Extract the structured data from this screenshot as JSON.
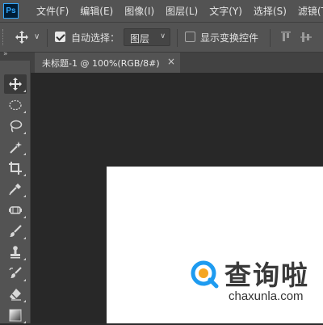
{
  "app": {
    "logo_text": "Ps"
  },
  "menu": {
    "items": [
      "文件(F)",
      "编辑(E)",
      "图像(I)",
      "图层(L)",
      "文字(Y)",
      "选择(S)",
      "滤镜(T)"
    ]
  },
  "options": {
    "auto_select_label": "自动选择：",
    "auto_select_checked": true,
    "layer_select_value": "图层",
    "show_transform_label": "显示变换控件",
    "show_transform_checked": false
  },
  "tools_panel": {
    "collapse_glyph": "»",
    "tools": [
      {
        "name": "move-tool-icon",
        "active": true
      },
      {
        "name": "marquee-tool-icon",
        "active": false
      },
      {
        "name": "lasso-tool-icon",
        "active": false
      },
      {
        "name": "magic-wand-tool-icon",
        "active": false
      },
      {
        "name": "crop-tool-icon",
        "active": false
      },
      {
        "name": "eyedropper-tool-icon",
        "active": false
      },
      {
        "name": "healing-brush-tool-icon",
        "active": false
      },
      {
        "name": "brush-tool-icon",
        "active": false
      },
      {
        "name": "clone-stamp-tool-icon",
        "active": false
      },
      {
        "name": "history-brush-tool-icon",
        "active": false
      },
      {
        "name": "eraser-tool-icon",
        "active": false
      },
      {
        "name": "gradient-tool-icon",
        "active": false
      }
    ]
  },
  "document_tab": {
    "title": "未标题-1 @ 100%(RGB/8#)",
    "close_glyph": "×"
  },
  "watermark": {
    "brand": "查询啦",
    "url": "chaxunla.com"
  },
  "colors": {
    "ui_panel": "#535353",
    "workspace": "#282828",
    "document_bg": "#ffffff",
    "watermark_accent": "#1e9bf0",
    "watermark_accent2": "#f5a623"
  }
}
